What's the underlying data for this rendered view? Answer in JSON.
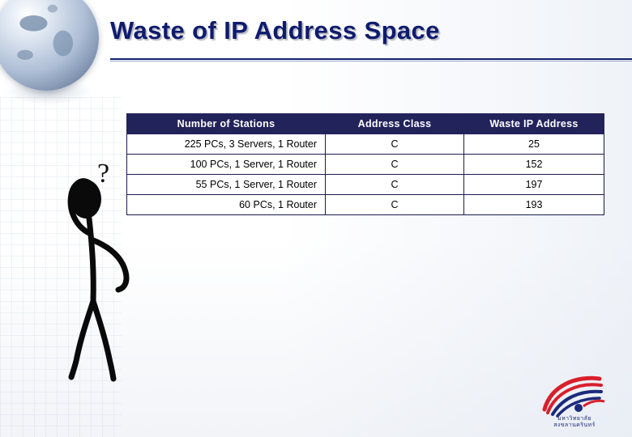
{
  "slide": {
    "title": "Waste of IP Address Space",
    "accent_color": "#0e1b6e",
    "header_bg_color": "#23235c"
  },
  "table": {
    "headers": [
      "Number of Stations",
      "Address Class",
      "Waste IP Address"
    ],
    "rows": [
      [
        "225 PCs, 3 Servers, 1 Router",
        "C",
        "25"
      ],
      [
        "100 PCs, 1 Server, 1 Router",
        "C",
        "152"
      ],
      [
        "55 PCs, 1 Server, 1 Router",
        "C",
        "197"
      ],
      [
        "60 PCs, 1 Router",
        "C",
        "193"
      ]
    ]
  },
  "decor": {
    "question_mark": "?",
    "logo_line1": "มหาวิทยาลัย",
    "logo_line2": "สงขลานครินทร์"
  }
}
